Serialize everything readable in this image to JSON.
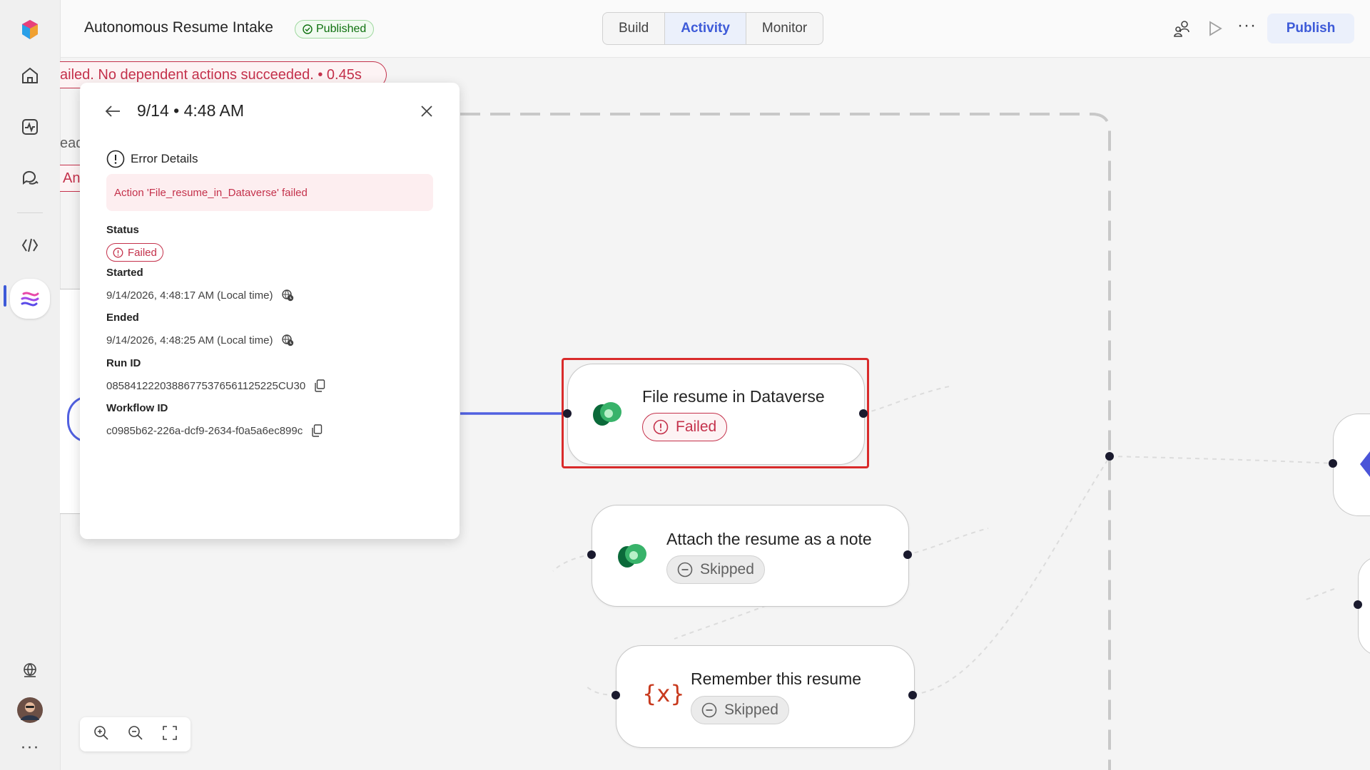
{
  "app": {
    "title": "Autonomous Resume Intake",
    "status_badge": "Published"
  },
  "tabs": [
    {
      "label": "Build",
      "active": false
    },
    {
      "label": "Activity",
      "active": true
    },
    {
      "label": "Monitor",
      "active": false
    }
  ],
  "toolbar": {
    "publish_label": "Publish"
  },
  "banner": {
    "text": "ailed. No dependent actions succeeded. • 0.45s"
  },
  "background_fragments": {
    "text_1": "ead",
    "text_2": "An"
  },
  "panel": {
    "title": "9/14 • 4:48 AM",
    "error_heading": "Error Details",
    "error_message": "Action 'File_resume_in_Dataverse' failed",
    "status_label": "Status",
    "status_value": "Failed",
    "started_label": "Started",
    "started_value": "9/14/2026, 4:48:17 AM (Local time)",
    "ended_label": "Ended",
    "ended_value": "9/14/2026, 4:48:25 AM (Local time)",
    "run_id_label": "Run ID",
    "run_id_value": "08584122203886775376561125225CU30",
    "workflow_id_label": "Workflow ID",
    "workflow_id_value": "c0985b62-226a-dcf9-2634-f0a5a6ec899c"
  },
  "nodes": [
    {
      "title": "File resume in Dataverse",
      "status": "Failed",
      "icon": "dataverse-icon",
      "selected": true
    },
    {
      "title": "Attach the resume as a note",
      "status": "Skipped",
      "icon": "dataverse-icon",
      "selected": false
    },
    {
      "title": "Remember this resume",
      "status": "Skipped",
      "icon": "variable-icon",
      "selected": false
    }
  ],
  "colors": {
    "accent": "#3d5ad8",
    "failed": "#c4314b",
    "published": "#0e700e",
    "selection": "#d92b2b"
  }
}
